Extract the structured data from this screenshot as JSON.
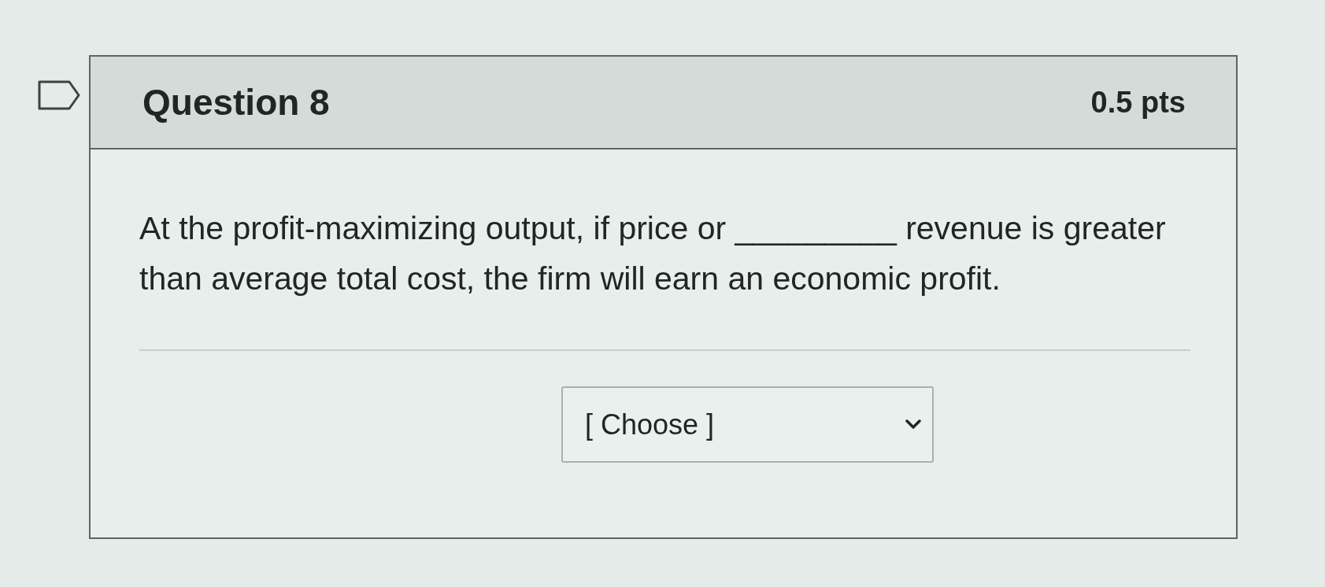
{
  "question": {
    "flagged": false,
    "title": "Question 8",
    "points": "0.5 pts",
    "text": "At the profit-maximizing output, if price or _________ revenue is greater than average total cost, the firm will earn an economic profit."
  },
  "answer_select": {
    "value": "[ Choose ]"
  }
}
